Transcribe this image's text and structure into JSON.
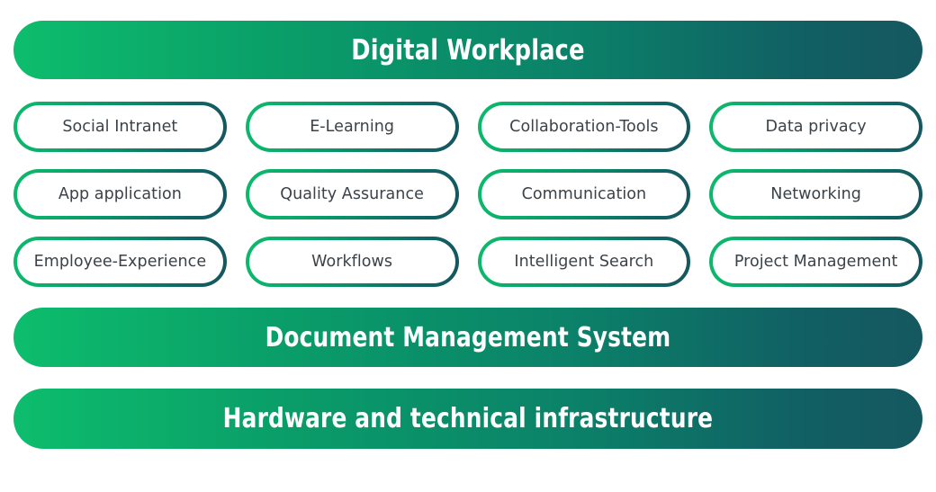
{
  "diagram": {
    "title_band": {
      "label": "Digital Workplace"
    },
    "capability_grid": {
      "rows": [
        {
          "cells": [
            {
              "label": "Social Intranet"
            },
            {
              "label": "E-Learning"
            },
            {
              "label": "Collaboration-Tools"
            },
            {
              "label": "Data privacy"
            }
          ]
        },
        {
          "cells": [
            {
              "label": "App application"
            },
            {
              "label": "Quality Assurance"
            },
            {
              "label": "Communication"
            },
            {
              "label": "Networking"
            }
          ]
        },
        {
          "cells": [
            {
              "label": "Employee-Experience"
            },
            {
              "label": "Workflows"
            },
            {
              "label": "Intelligent Search"
            },
            {
              "label": "Project Management"
            }
          ]
        }
      ]
    },
    "foundation_bands": [
      {
        "label": "Document Management System"
      },
      {
        "label": "Hardware and technical infrastructure"
      }
    ],
    "colors": {
      "gradient_start": "#0dbd6c",
      "gradient_mid": "#0a8a62",
      "gradient_end": "#15585f",
      "band_text": "#ffffff",
      "pill_text": "#3b4248",
      "pill_fill": "#ffffff",
      "background": "#ffffff"
    }
  }
}
